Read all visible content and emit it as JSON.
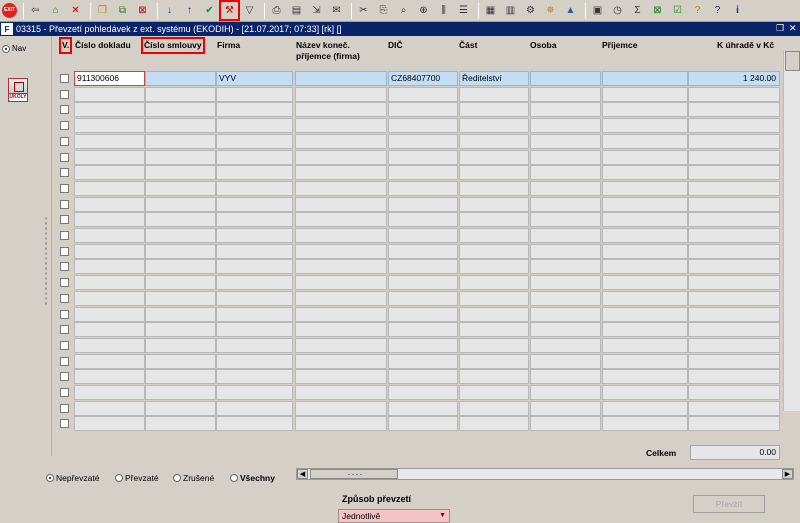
{
  "toolbar": {
    "exit_label": "EXIT",
    "highlighted_tool": "wrench-icon",
    "buttons": [
      "exit-icon",
      "back-icon",
      "home-icon",
      "stop-icon",
      "open-icon",
      "copy-icon",
      "delete-icon",
      "sort-asc-icon",
      "sort-desc-icon",
      "confirm-icon",
      "wrench-icon",
      "filter-icon",
      "print-icon",
      "print-preview-icon",
      "export-icon",
      "mail-icon",
      "cut-icon",
      "paste-icon",
      "find-icon",
      "zoom-icon",
      "columns-icon",
      "rows-icon",
      "report-icon",
      "chart-icon",
      "settings-icon",
      "star-icon",
      "warning-icon",
      "image-icon",
      "clock-icon",
      "sum-icon",
      "excel-icon",
      "check-icon",
      "help-icon",
      "info-icon"
    ]
  },
  "window": {
    "app_icon": "F",
    "title": "03315 - Převzetí pohledávek z ext. systému (EKODIH) - [21.07.2017; 07:33] [rk] []"
  },
  "left_panel": {
    "nav_label": "Nav",
    "tasks_label": "ÚKOLY"
  },
  "columns": {
    "v": "V.",
    "doc_number": "Číslo dokladu",
    "contract_number": "Číslo smlouvy",
    "company": "Firma",
    "final_recipient_1": "Název koneč.",
    "final_recipient_2": "příjemce (firma)",
    "vat_id": "DIČ",
    "part": "Část",
    "person": "Osoba",
    "recipient": "Příjemce",
    "amount_due": "K úhradě v Kč"
  },
  "rows": [
    {
      "doc_number": "911300606",
      "contract_number": "",
      "company": "VYV",
      "final_recipient": "",
      "vat_id": "CZ68407700",
      "part": "Ředitelství",
      "person": "",
      "recipient": "",
      "amount_due": "1 240.00"
    }
  ],
  "empty_row_count": 22,
  "footer": {
    "total_label": "Celkem",
    "total_value": "0.00"
  },
  "filters": {
    "options": [
      "Nepřevzaté",
      "Převzaté",
      "Zrušené",
      "Všechny"
    ],
    "selected": "Nepřevzaté"
  },
  "transfer": {
    "method_label": "Způsob převzetí",
    "method_value": "Jednotlivě",
    "button_label": "Převzít"
  },
  "colors": {
    "title_bar": "#0a246a",
    "highlight": "#e00000",
    "selected_row": "#c5dcf5",
    "required_field": "#f4c4c4"
  }
}
